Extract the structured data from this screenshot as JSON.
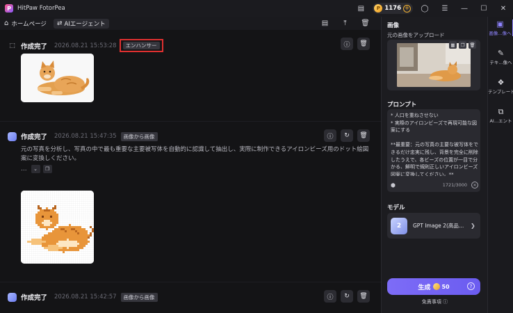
{
  "app": {
    "title": "HitPaw FotorPea",
    "coins": "1176"
  },
  "toolbar": {
    "home_label": "ホームページ",
    "agent_label": "AIエージェント"
  },
  "cards": [
    {
      "title": "作成完了",
      "time": "2026.08.21  15:53:28",
      "tag": "エンハンサー"
    },
    {
      "title": "作成完了",
      "time": "2026.08.21  15:47:35",
      "tag": "画像から画像",
      "description": "元の写真を分析し、写真の中で最も重要な主要被写体を自動的に認識して抽出し、実際に制作できるアイロンビーズ用のドット絵図案に変換しください。",
      "ellipsis": "..."
    },
    {
      "title": "作成完了",
      "time": "2026.08.21  15:42:57",
      "tag": "画像から画像"
    }
  ],
  "panel": {
    "image_section_title": "画像",
    "upload_label": "元の画像をアップロード",
    "prompt_title": "プロンプト",
    "prompt_text": "* 人口を重ねさせない\n* 実際のアイロンビーズで再現可能な図案にする\n\n**最重要：元の写真の主要な被写体をできるだけ忠実に残し、背景を完全に削除したうえで、各ビーズの位置が一目で分かる、鮮明で規則正しいアイロンビーズ図案に変換してください。**",
    "char_count": "1721/3000",
    "model_title": "モデル",
    "model_name": "GPT Image 2(高品質) ...",
    "model_badge": "2",
    "generate_label": "生成",
    "generate_cost": "50",
    "disclaimer": "免責事項"
  },
  "sidenav": [
    {
      "label": "画像...像へ",
      "icon": "image-edit-icon",
      "active": true
    },
    {
      "label": "テキ...像へ",
      "icon": "text-to-image-icon",
      "active": false
    },
    {
      "label": "テンプレート",
      "icon": "template-icon",
      "active": false
    },
    {
      "label": "AI...エント",
      "icon": "ai-agent-icon",
      "active": false
    }
  ],
  "colors": {
    "accent": "#7d6cf7",
    "highlight_border": "#e03030",
    "background": "#141416"
  },
  "pixel_cat_colors": {
    "orange": "#e8953a",
    "dark": "#b86620",
    "light": "#f6c27a",
    "cream": "#fde7c4",
    "outline": "#7a3d12"
  }
}
